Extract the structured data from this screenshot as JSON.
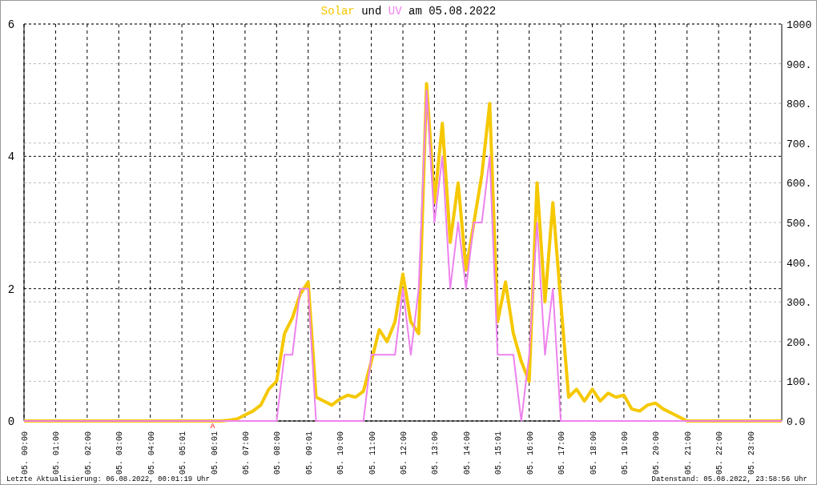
{
  "title": {
    "connector": "und",
    "date_text": "am 05.08.2022"
  },
  "chart": {
    "chart_data": {
      "type": "line",
      "grid": true,
      "ylim": [
        0,
        6
      ],
      "y2lim": [
        0,
        1000
      ],
      "categories": [
        "05. 00:00",
        null,
        null,
        null,
        "05. 01:00",
        null,
        null,
        null,
        "05. 02:00",
        null,
        null,
        null,
        "05. 03:00",
        null,
        null,
        null,
        "05. 04:00",
        null,
        null,
        null,
        "05. 05:01",
        null,
        null,
        null,
        "05. 06:01",
        null,
        null,
        null,
        "05. 07:00",
        null,
        null,
        null,
        "05. 08:00",
        null,
        null,
        null,
        "05. 09:01",
        null,
        null,
        null,
        "05. 10:00",
        null,
        null,
        null,
        "05. 11:00",
        null,
        null,
        null,
        "05. 12:00",
        null,
        null,
        null,
        "05. 13:00",
        null,
        null,
        null,
        "05. 14:00",
        null,
        null,
        null,
        "05. 15:01",
        null,
        null,
        null,
        "05. 16:00",
        null,
        null,
        null,
        "05. 17:00",
        null,
        null,
        null,
        "05. 18:00",
        null,
        null,
        null,
        "05. 19:00",
        null,
        null,
        null,
        "05. 20:00",
        null,
        null,
        null,
        "05. 21:00",
        null,
        null,
        null,
        "05. 22:00",
        null,
        null,
        null,
        "05. 23:00",
        null,
        null,
        null,
        null
      ],
      "series": [
        {
          "name": "Solar",
          "color": "#f5c800",
          "axis": "y2",
          "values": [
            0,
            0,
            0,
            0,
            0,
            0,
            0,
            0,
            0,
            0,
            0,
            0,
            0,
            0,
            0,
            0,
            0,
            0,
            0,
            0,
            0,
            0,
            0,
            0,
            0,
            0,
            2,
            5,
            15,
            25,
            40,
            80,
            100,
            220,
            260,
            320,
            350,
            60,
            50,
            40,
            55,
            65,
            60,
            75,
            150,
            230,
            200,
            250,
            370,
            250,
            220,
            850,
            550,
            750,
            450,
            600,
            380,
            500,
            620,
            800,
            250,
            350,
            220,
            150,
            100,
            600,
            300,
            550,
            300,
            60,
            80,
            50,
            80,
            50,
            70,
            60,
            65,
            30,
            25,
            40,
            45,
            30,
            20,
            10,
            0,
            0,
            0,
            0,
            0,
            0,
            0,
            0,
            0,
            0,
            0,
            0,
            0
          ]
        },
        {
          "name": "UV",
          "color": "#ee82ee",
          "values": [
            0,
            0,
            0,
            0,
            0,
            0,
            0,
            0,
            0,
            0,
            0,
            0,
            0,
            0,
            0,
            0,
            0,
            0,
            0,
            0,
            0,
            0,
            0,
            0,
            0,
            0,
            0,
            0,
            0,
            0,
            0,
            0,
            0,
            1,
            1,
            2,
            2,
            0,
            0,
            0,
            0,
            0,
            0,
            0,
            1,
            1,
            1,
            1,
            2,
            1,
            2,
            5,
            3,
            4,
            2,
            3,
            2,
            3,
            3,
            4,
            1,
            1,
            1,
            0,
            1,
            3,
            1,
            2,
            0,
            0,
            0,
            0,
            0,
            0,
            0,
            0,
            0,
            0,
            0,
            0,
            0,
            0,
            0,
            0,
            0,
            0,
            0,
            0,
            0,
            0,
            0,
            0,
            0,
            0,
            0,
            0,
            0
          ]
        }
      ],
      "yticks": [
        0,
        2,
        4,
        6
      ],
      "y2ticks": [
        {
          "value": 0,
          "label": "0.0"
        },
        {
          "value": 100,
          "label": "100."
        },
        {
          "value": 200,
          "label": "200."
        },
        {
          "value": 300,
          "label": "300."
        },
        {
          "value": 400,
          "label": "400."
        },
        {
          "value": 500,
          "label": "500."
        },
        {
          "value": 600,
          "label": "600."
        },
        {
          "value": 700,
          "label": "700."
        },
        {
          "value": 800,
          "label": "800."
        },
        {
          "value": 900,
          "label": "900."
        },
        {
          "value": 1000,
          "label": "1000"
        }
      ],
      "annotations": [
        "A"
      ]
    }
  },
  "footer": {
    "last_update": "Letzte Aktualisierung: 06.08.2022, 00:01:19 Uhr",
    "data_time": "Datenstand: 05.08.2022, 23:58:56 Uhr"
  }
}
